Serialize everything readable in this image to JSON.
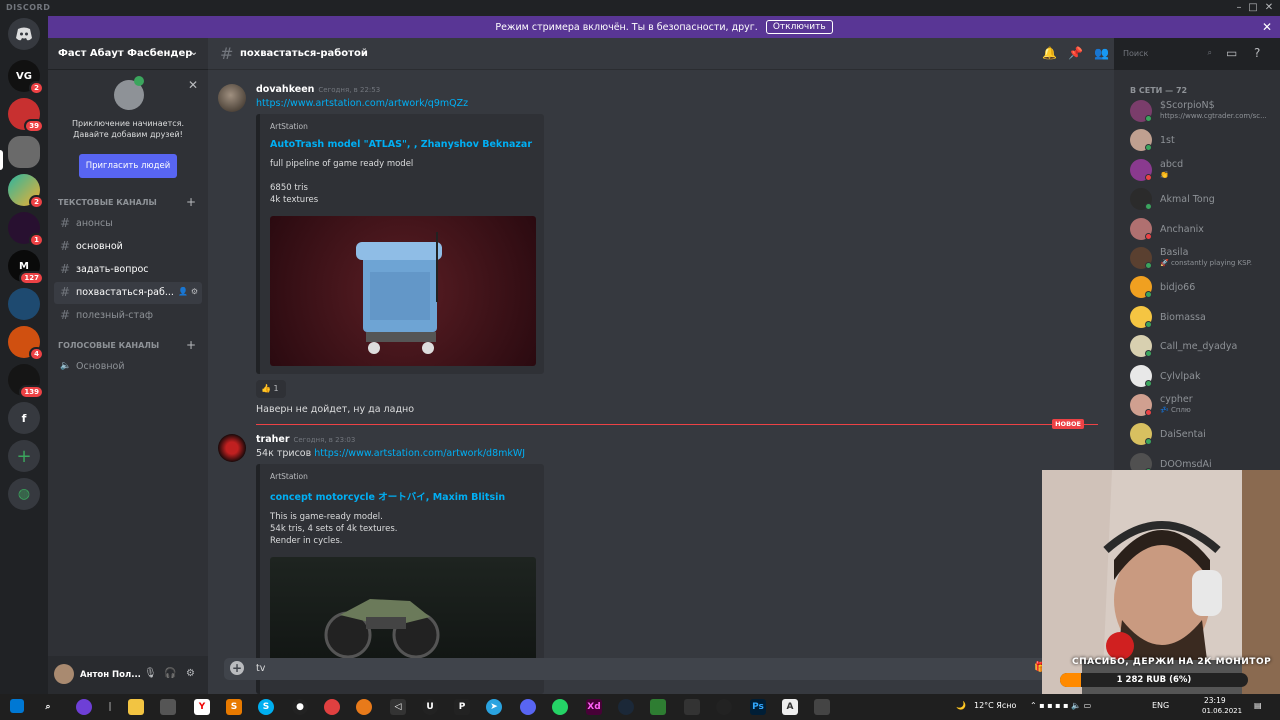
{
  "app": {
    "brand": "DISCORD"
  },
  "banner": {
    "text": "Режим стримера включён. Ты в безопасности, друг.",
    "button": "Отключить"
  },
  "server": {
    "name": "Фаст Абаут Фасбендер"
  },
  "invite": {
    "line1": "Приключение начинается.",
    "line2": "Давайте добавим друзей!",
    "button": "Пригласить людей"
  },
  "categories": {
    "text": "ТЕКСТОВЫЕ КАНАЛЫ",
    "voice": "ГОЛОСОВЫЕ КАНАЛЫ"
  },
  "channels": [
    "анонсы",
    "основной",
    "задать-вопрос",
    "похвастаться-раб...",
    "полезный-стаф"
  ],
  "voice_channels": [
    "Основной"
  ],
  "user": {
    "name": "Антон Пол..."
  },
  "chat": {
    "title": "похвастаться-работой",
    "search_placeholder": "Поиск",
    "composer_value": "tv"
  },
  "messages": [
    {
      "author": "dovahkeen",
      "timestamp": "Сегодня, в 22:53",
      "link": "https://www.artstation.com/artwork/q9mQZz",
      "embed": {
        "provider": "ArtStation",
        "title": "AutoTrash model \"ATLAS\", , Zhanyshov Beknazar",
        "desc": "full pipeline of game ready model\n\n6850 tris\n4k textures"
      },
      "reaction": {
        "emoji": "👍",
        "count": "1"
      },
      "followup": "Наверн не дойдет, ну да ладно"
    },
    {
      "author": "traher",
      "timestamp": "Сегодня, в 23:03",
      "prefix": "54к трисов ",
      "link": "https://www.artstation.com/artwork/d8mkWJ",
      "embed": {
        "provider": "ArtStation",
        "title": "concept motorcycle オートバイ, Maxim Blitsin",
        "desc": "This is game-ready model.\n54k tris, 4 sets of 4k textures.\nRender in cycles."
      }
    }
  ],
  "new_marker": "НОВОЕ",
  "members": {
    "header": "В СЕТИ — 72",
    "list": [
      {
        "name": "$ScorpioN$",
        "status": "https://www.cgtrader.com/sc...",
        "color": "#7a3d6b",
        "presence": "#3ba55d"
      },
      {
        "name": "1st",
        "status": "",
        "color": "#c0a090",
        "presence": "#3ba55d"
      },
      {
        "name": "abcd",
        "status": "👏",
        "color": "#8a3a8f",
        "presence": "#ed4245"
      },
      {
        "name": "Akmal Tong",
        "status": "",
        "color": "#2b2b2b",
        "presence": "#3ba55d"
      },
      {
        "name": "Anchanix",
        "status": "",
        "color": "#b07070",
        "presence": "#ed4245"
      },
      {
        "name": "Basila",
        "status": "🚀 constantly playing KSP.",
        "color": "#5a4030",
        "presence": "#3ba55d"
      },
      {
        "name": "bidjo66",
        "status": "",
        "color": "#f0a020",
        "presence": "#3ba55d"
      },
      {
        "name": "Biomassa",
        "status": "",
        "color": "#f5c542",
        "presence": "#3ba55d"
      },
      {
        "name": "Call_me_dyadya",
        "status": "",
        "color": "#d8d0b0",
        "presence": "#3ba55d"
      },
      {
        "name": "Cylvlpak",
        "status": "",
        "color": "#e8e8e8",
        "presence": "#3ba55d"
      },
      {
        "name": "cypher",
        "status": "💤 Сплю",
        "color": "#d0a090",
        "presence": "#ed4245"
      },
      {
        "name": "DaiSentai",
        "status": "",
        "color": "#d8c060",
        "presence": "#3ba55d"
      },
      {
        "name": "DOOmsdAi",
        "status": "",
        "color": "#505050",
        "presence": "#3ba55d"
      }
    ]
  },
  "donation": {
    "title": "СПАСИБО, ДЕРЖИ НА 2К МОНИТОР",
    "amount": "1 282 RUB (6%)",
    "progress": 0.06
  },
  "taskbar": {
    "weather": "12°C Ясно",
    "lang": "ENG",
    "time": "23:19",
    "date": "01.06.2021"
  },
  "colors": {
    "accent": "#5865f2",
    "banner": "#593695",
    "link": "#00aff4",
    "new": "#ed4245"
  }
}
